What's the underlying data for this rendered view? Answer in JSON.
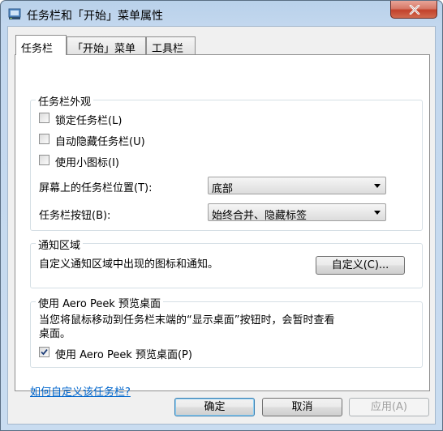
{
  "window": {
    "title": "任务栏和「开始」菜单属性",
    "close_label": "close"
  },
  "tabs": [
    {
      "label": "任务栏",
      "active": true
    },
    {
      "label": "「开始」菜单",
      "active": false
    },
    {
      "label": "工具栏",
      "active": false
    }
  ],
  "appearance": {
    "title": "任务栏外观",
    "lock": {
      "label": "锁定任务栏(L)",
      "checked": false
    },
    "autohide": {
      "label": "自动隐藏任务栏(U)",
      "checked": false
    },
    "small_icons": {
      "label": "使用小图标(I)",
      "checked": false
    },
    "position_label": "屏幕上的任务栏位置(T):",
    "position_value": "底部",
    "buttons_label": "任务栏按钮(B):",
    "buttons_value": "始终合并、隐藏标签"
  },
  "notification": {
    "title": "通知区域",
    "description": "自定义通知区域中出现的图标和通知。",
    "customize_button": "自定义(C)..."
  },
  "aero_peek": {
    "title": "使用 Aero Peek 预览桌面",
    "description_line1": "当您将鼠标移动到任务栏末端的“显示桌面”按钮时，会暂时查看",
    "description_line2": "桌面。",
    "checkbox": {
      "label": "使用 Aero Peek 预览桌面(P)",
      "checked": true
    }
  },
  "help_link": "如何自定义该任务栏?",
  "footer": {
    "ok": "确定",
    "cancel": "取消",
    "apply": "应用(A)"
  },
  "colors": {
    "link": "#0066cc",
    "close_button": "#c2412a",
    "titlebar": "#b9d1ea"
  }
}
